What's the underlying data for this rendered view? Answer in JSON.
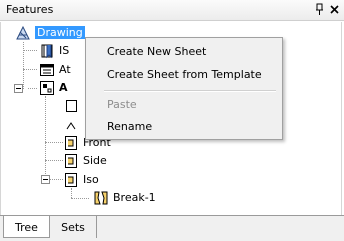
{
  "panel": {
    "title": "Features",
    "pin_icon": "pin-icon",
    "close_icon": "close-icon"
  },
  "tree": {
    "drawing": {
      "label": "Drawing",
      "icon": "drawing-icon"
    },
    "row2": {
      "label": "IS",
      "icon": "book-icon"
    },
    "row3": {
      "label": "At",
      "icon": "table-icon"
    },
    "row4": {
      "label": "A",
      "icon": "sheet-icon"
    },
    "front": {
      "label": "Front",
      "icon": "view-icon"
    },
    "side": {
      "label": "Side",
      "icon": "view-icon"
    },
    "iso": {
      "label": "Iso",
      "icon": "view-icon"
    },
    "break": {
      "label": "Break-1",
      "icon": "break-icon"
    }
  },
  "context_menu": {
    "create_new_sheet": "Create New Sheet",
    "create_from_template": "Create Sheet from Template",
    "paste": "Paste",
    "rename": "Rename"
  },
  "tabs": {
    "tree": "Tree",
    "sets": "Sets"
  }
}
